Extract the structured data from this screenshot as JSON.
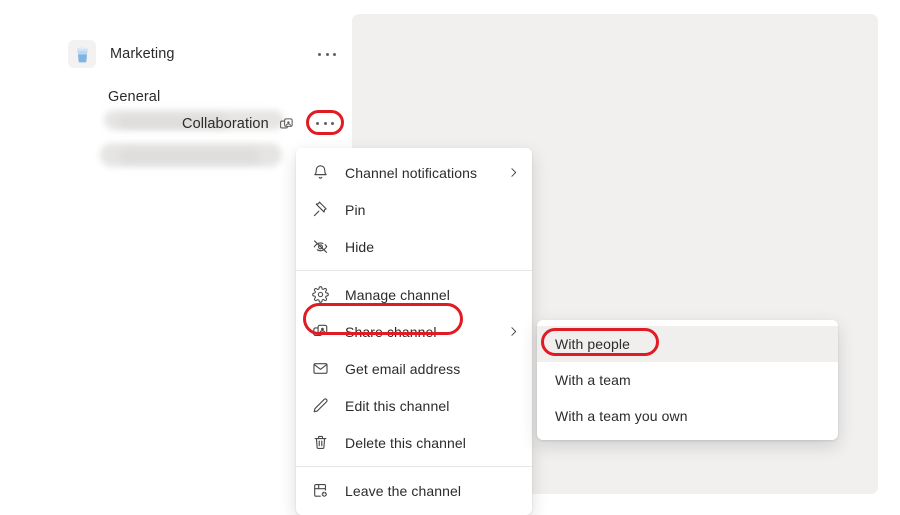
{
  "tree": {
    "team": {
      "name": "Marketing",
      "avatar_icon": "team-avatar-icon",
      "options_icon": "more-options-icon"
    },
    "channels": [
      {
        "name": "General",
        "shared": false
      },
      {
        "name": "Collaboration",
        "shared": true,
        "shared_icon": "shared-channel-icon",
        "options_icon": "more-options-icon"
      }
    ]
  },
  "context_menu": {
    "items": [
      {
        "label": "Channel notifications",
        "icon": "bell-icon",
        "has_submenu": true
      },
      {
        "label": "Pin",
        "icon": "pin-icon",
        "has_submenu": false
      },
      {
        "label": "Hide",
        "icon": "eye-off-icon",
        "has_submenu": false
      },
      {
        "separator_after": true
      },
      {
        "label": "Manage channel",
        "icon": "gear-icon",
        "has_submenu": false
      },
      {
        "label": "Share channel",
        "icon": "share-channel-icon",
        "has_submenu": true,
        "highlighted": true
      },
      {
        "label": "Get email address",
        "icon": "envelope-icon",
        "has_submenu": false
      },
      {
        "label": "Edit this channel",
        "icon": "pencil-icon",
        "has_submenu": false
      },
      {
        "label": "Delete this channel",
        "icon": "trash-icon",
        "has_submenu": false
      },
      {
        "separator_after": true
      },
      {
        "label": "Leave the channel",
        "icon": "leave-channel-icon",
        "has_submenu": false
      }
    ]
  },
  "share_submenu": {
    "items": [
      {
        "label": "With people",
        "hovered": true,
        "highlighted": true
      },
      {
        "label": "With a team",
        "hovered": false,
        "highlighted": false
      },
      {
        "label": "With a team you own",
        "hovered": false,
        "highlighted": false
      }
    ]
  },
  "annotation": {
    "highlight_color": "#e01b24",
    "targets": [
      "collaboration-more-options",
      "share-channel",
      "with-people"
    ]
  },
  "colors": {
    "content_panel": "#f1f0ef",
    "menu_background": "#ffffff",
    "hover_row": "#f0efee",
    "text": "#2b2b2b"
  }
}
